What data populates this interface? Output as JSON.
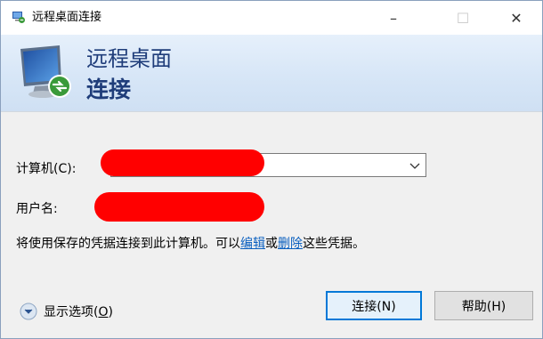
{
  "window": {
    "title": "远程桌面连接",
    "minimize_label": "–",
    "maximize_label": "☐",
    "close_label": "✕"
  },
  "banner": {
    "line1": "远程桌面",
    "line2": "连接"
  },
  "form": {
    "computer_label": "计算机(C):",
    "computer_value": "",
    "user_label": "用户名:",
    "user_value": ""
  },
  "info": {
    "prefix": "将使用保存的凭据连接到此计算机。可以",
    "edit_link": "编辑",
    "or": "或",
    "delete_link": "删除",
    "suffix": "这些凭据。"
  },
  "footer": {
    "show_options_text": "显示选项(",
    "show_options_key": "O",
    "show_options_close": ")",
    "connect_label": "连接(N)",
    "help_label": "帮助(H)"
  },
  "colors": {
    "accent": "#0078d7",
    "banner_text": "#1f3d7a",
    "link": "#0a5fbf",
    "redaction": "#ff0000"
  },
  "icons": {
    "title": "remote-desktop-icon",
    "banner": "remote-desktop-monitor-icon",
    "combo": "chevron-down-icon",
    "options": "expand-circle-icon"
  }
}
